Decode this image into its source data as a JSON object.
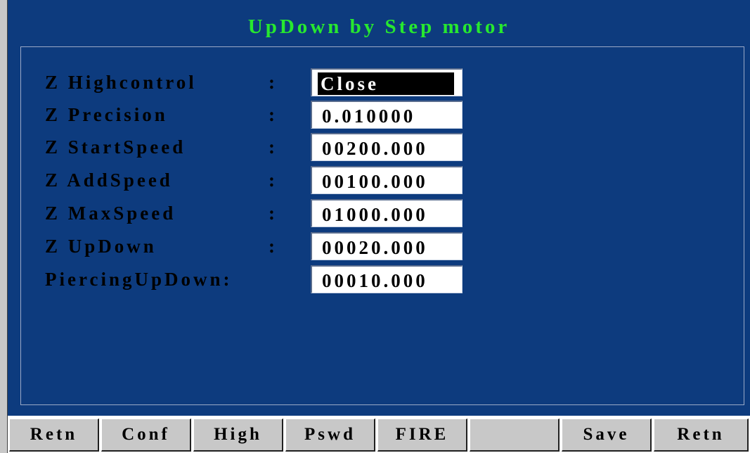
{
  "window": {
    "title": "UpDown by Step motor"
  },
  "params": [
    {
      "label": "Z Highcontrol",
      "colon": ":",
      "value": "Close",
      "selected": true
    },
    {
      "label": "Z Precision",
      "colon": ":",
      "value": "0.010000",
      "selected": false
    },
    {
      "label": "Z StartSpeed",
      "colon": ":",
      "value": "00200.000",
      "selected": false
    },
    {
      "label": "Z AddSpeed",
      "colon": ":",
      "value": "00100.000",
      "selected": false
    },
    {
      "label": "Z MaxSpeed",
      "colon": ":",
      "value": "01000.000",
      "selected": false
    },
    {
      "label": "Z UpDown",
      "colon": ":",
      "value": "00020.000",
      "selected": false
    },
    {
      "label": "PiercingUpDown:",
      "colon": "",
      "value": "00010.000",
      "selected": false
    }
  ],
  "toolbar": {
    "buttons": [
      "Retn",
      "Conf",
      "High",
      "Pswd",
      "FIRE",
      "",
      "Save",
      "Retn"
    ]
  },
  "colors": {
    "background": "#0d3b7e",
    "title": "#27e82f",
    "button_face": "#c8c8c8",
    "selected_field": "#000000"
  }
}
